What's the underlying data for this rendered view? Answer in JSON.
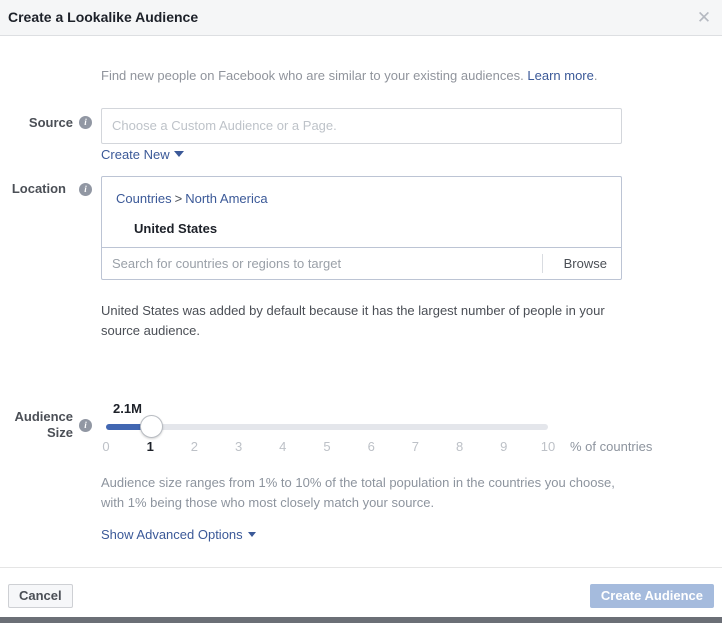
{
  "dialog": {
    "title": "Create a Lookalike Audience",
    "close_icon": "close-icon"
  },
  "intro": {
    "text": "Find new people on Facebook who are similar to your existing audiences.",
    "link_label": "Learn more",
    "period": "."
  },
  "source": {
    "label": "Source",
    "info_glyph": "i",
    "placeholder": "Choose a Custom Audience or a Page.",
    "value": "",
    "create_new_label": "Create New"
  },
  "location": {
    "label": "Location",
    "info_glyph": "i",
    "breadcrumb": {
      "root": "Countries",
      "separator": ">",
      "current": "North America"
    },
    "selected_country": "United States",
    "search_placeholder": "Search for countries or regions to target",
    "browse_label": "Browse",
    "note": "United States was added by default because it has the largest number of people in your source audience."
  },
  "audience_size": {
    "label_line1": "Audience",
    "label_line2": "Size",
    "info_glyph": "i",
    "value_badge": "2.1M",
    "current_percent": 1,
    "min": 0,
    "max": 10,
    "ticks": [
      "0",
      "1",
      "2",
      "3",
      "4",
      "5",
      "6",
      "7",
      "8",
      "9",
      "10"
    ],
    "unit_label": "% of countries",
    "note": "Audience size ranges from 1% to 10% of the total population in the countries you choose, with 1% being those who most closely match your source.",
    "advanced_label": "Show Advanced Options"
  },
  "footer": {
    "cancel_label": "Cancel",
    "submit_label": "Create Audience"
  },
  "colors": {
    "brand_blue": "#4267b2",
    "link_blue": "#3b5998",
    "header_bg": "#f5f6f7",
    "primary_disabled": "#a5bbdd",
    "track_gray": "#e4e6eb",
    "text_dark": "#1d2129",
    "text_muted": "#8d949e"
  }
}
